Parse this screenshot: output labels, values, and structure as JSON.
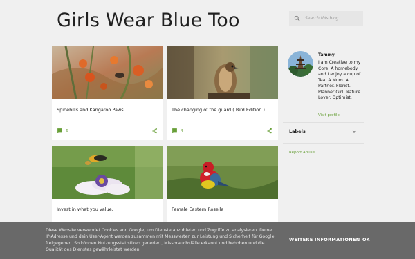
{
  "header": {
    "blog_title": "Girls Wear Blue Too"
  },
  "search": {
    "placeholder": "Search this blog"
  },
  "posts": [
    {
      "title": "Spinebills and Kangaroo Paws",
      "comment_count": "6"
    },
    {
      "title": "The changing of the guard ( Bird Edition )",
      "comment_count": "4"
    },
    {
      "title": "Invest in what you value."
    },
    {
      "title": "Female Eastern Rosella"
    }
  ],
  "profile": {
    "name": "Tammy",
    "bio": "I am Creative to my Core. A homebody and I enjoy a cup of Tea. A Mum. A Partner. Florist. Planner Girl. Nature Lover. Optimist.",
    "visit_link": "Visit profile"
  },
  "sidebar": {
    "labels_title": "Labels",
    "report_abuse": "Report Abuse"
  },
  "cookie_notice": {
    "text": "Diese Website verwendet Cookies von Google, um Dienste anzubieten und Zugriffe zu analysieren. Deine IP-Adresse und dein User-Agent werden zusammen mit Messwerten zur Leistung und Sicherheit für Google freigegeben. So können Nutzungsstatistiken generiert, Missbrauchsfälle erkannt und behoben und die Qualität des Dienstes gewährleistet werden.",
    "more_info": "WEITERE INFORMATIONEN",
    "ok": "OK"
  },
  "colors": {
    "accent": "#689f38",
    "page_background": "#f0f0f0",
    "cookie_bar": "#646464"
  },
  "icons": {
    "search": "search-icon",
    "comment": "comment-icon",
    "share": "share-icon",
    "chevron": "chevron-down-icon"
  }
}
